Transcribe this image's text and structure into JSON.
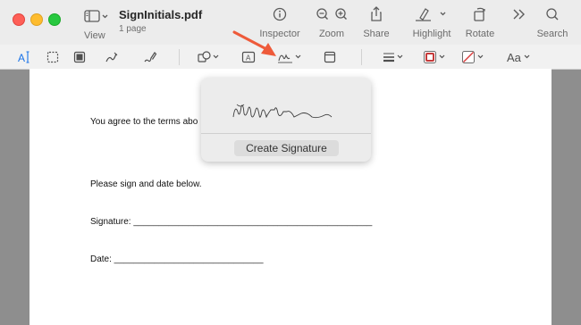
{
  "window": {
    "title": "SignInitials.pdf",
    "subtitle": "1 page"
  },
  "toolbar": {
    "view_label": "View",
    "inspector_label": "Inspector",
    "zoom_label": "Zoom",
    "share_label": "Share",
    "highlight_label": "Highlight",
    "rotate_label": "Rotate",
    "search_label": "Search"
  },
  "markup": {
    "text_style_label": "Aa"
  },
  "document": {
    "line1": "You agree to the terms abo",
    "line2": "Please sign and date below.",
    "signature_line": "Signature:   ________________________________________________",
    "date_line": "Date:   ______________________________"
  },
  "signature_popover": {
    "create_label": "Create Signature"
  },
  "colors": {
    "accent": "#1a73e8",
    "close": "#fe5f57",
    "minimize": "#febc2e",
    "maximize": "#28c840",
    "arrow": "#ee5a3a",
    "border_color": "#c53a3a"
  }
}
